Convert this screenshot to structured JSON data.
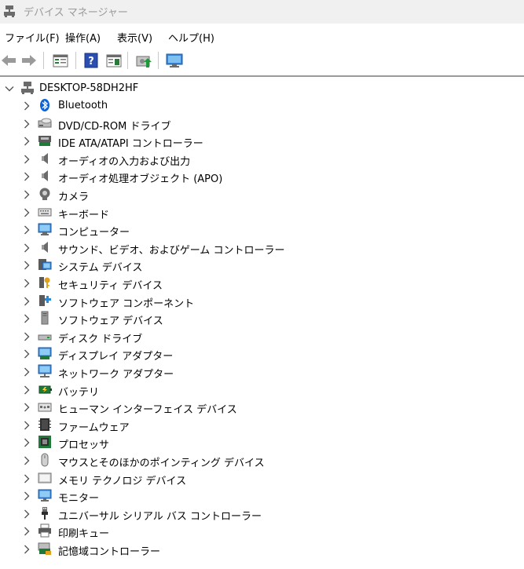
{
  "window": {
    "title": "デバイス マネージャー"
  },
  "menu": [
    "ファイル(F)",
    "操作(A)",
    "表示(V)",
    "ヘルプ(H)"
  ],
  "tree": {
    "root": "DESKTOP-58DH2HF",
    "items": [
      {
        "label": "Bluetooth",
        "icon": "bluetooth-icon"
      },
      {
        "label": "DVD/CD-ROM ドライブ",
        "icon": "dvd-drive-icon"
      },
      {
        "label": "IDE ATA/ATAPI コントローラー",
        "icon": "ide-controller-icon"
      },
      {
        "label": "オーディオの入力および出力",
        "icon": "speaker-icon"
      },
      {
        "label": "オーディオ処理オブジェクト (APO)",
        "icon": "speaker-icon"
      },
      {
        "label": "カメラ",
        "icon": "camera-icon"
      },
      {
        "label": "キーボード",
        "icon": "keyboard-icon"
      },
      {
        "label": "コンピューター",
        "icon": "computer-icon"
      },
      {
        "label": "サウンド、ビデオ、およびゲーム コントローラー",
        "icon": "speaker-icon"
      },
      {
        "label": "システム デバイス",
        "icon": "system-devices-icon"
      },
      {
        "label": "セキュリティ デバイス",
        "icon": "security-key-icon"
      },
      {
        "label": "ソフトウェア コンポーネント",
        "icon": "software-component-icon"
      },
      {
        "label": "ソフトウェア デバイス",
        "icon": "software-device-icon"
      },
      {
        "label": "ディスク ドライブ",
        "icon": "disk-drive-icon"
      },
      {
        "label": "ディスプレイ アダプター",
        "icon": "display-adapter-icon"
      },
      {
        "label": "ネットワーク アダプター",
        "icon": "network-adapter-icon"
      },
      {
        "label": "バッテリ",
        "icon": "battery-icon"
      },
      {
        "label": "ヒューマン インターフェイス デバイス",
        "icon": "hid-icon"
      },
      {
        "label": "ファームウェア",
        "icon": "firmware-icon"
      },
      {
        "label": "プロセッサ",
        "icon": "processor-icon"
      },
      {
        "label": "マウスとそのほかのポインティング デバイス",
        "icon": "mouse-icon"
      },
      {
        "label": "メモリ テクノロジ デバイス",
        "icon": "memory-icon"
      },
      {
        "label": "モニター",
        "icon": "monitor-icon"
      },
      {
        "label": "ユニバーサル シリアル バス コントローラー",
        "icon": "usb-icon"
      },
      {
        "label": "印刷キュー",
        "icon": "printer-icon"
      },
      {
        "label": "記憶域コントローラー",
        "icon": "storage-controller-icon"
      }
    ]
  },
  "colors": {
    "accent": "#1e6fd9",
    "bluetooth": "#0a64d8",
    "chevron": "#555555"
  }
}
